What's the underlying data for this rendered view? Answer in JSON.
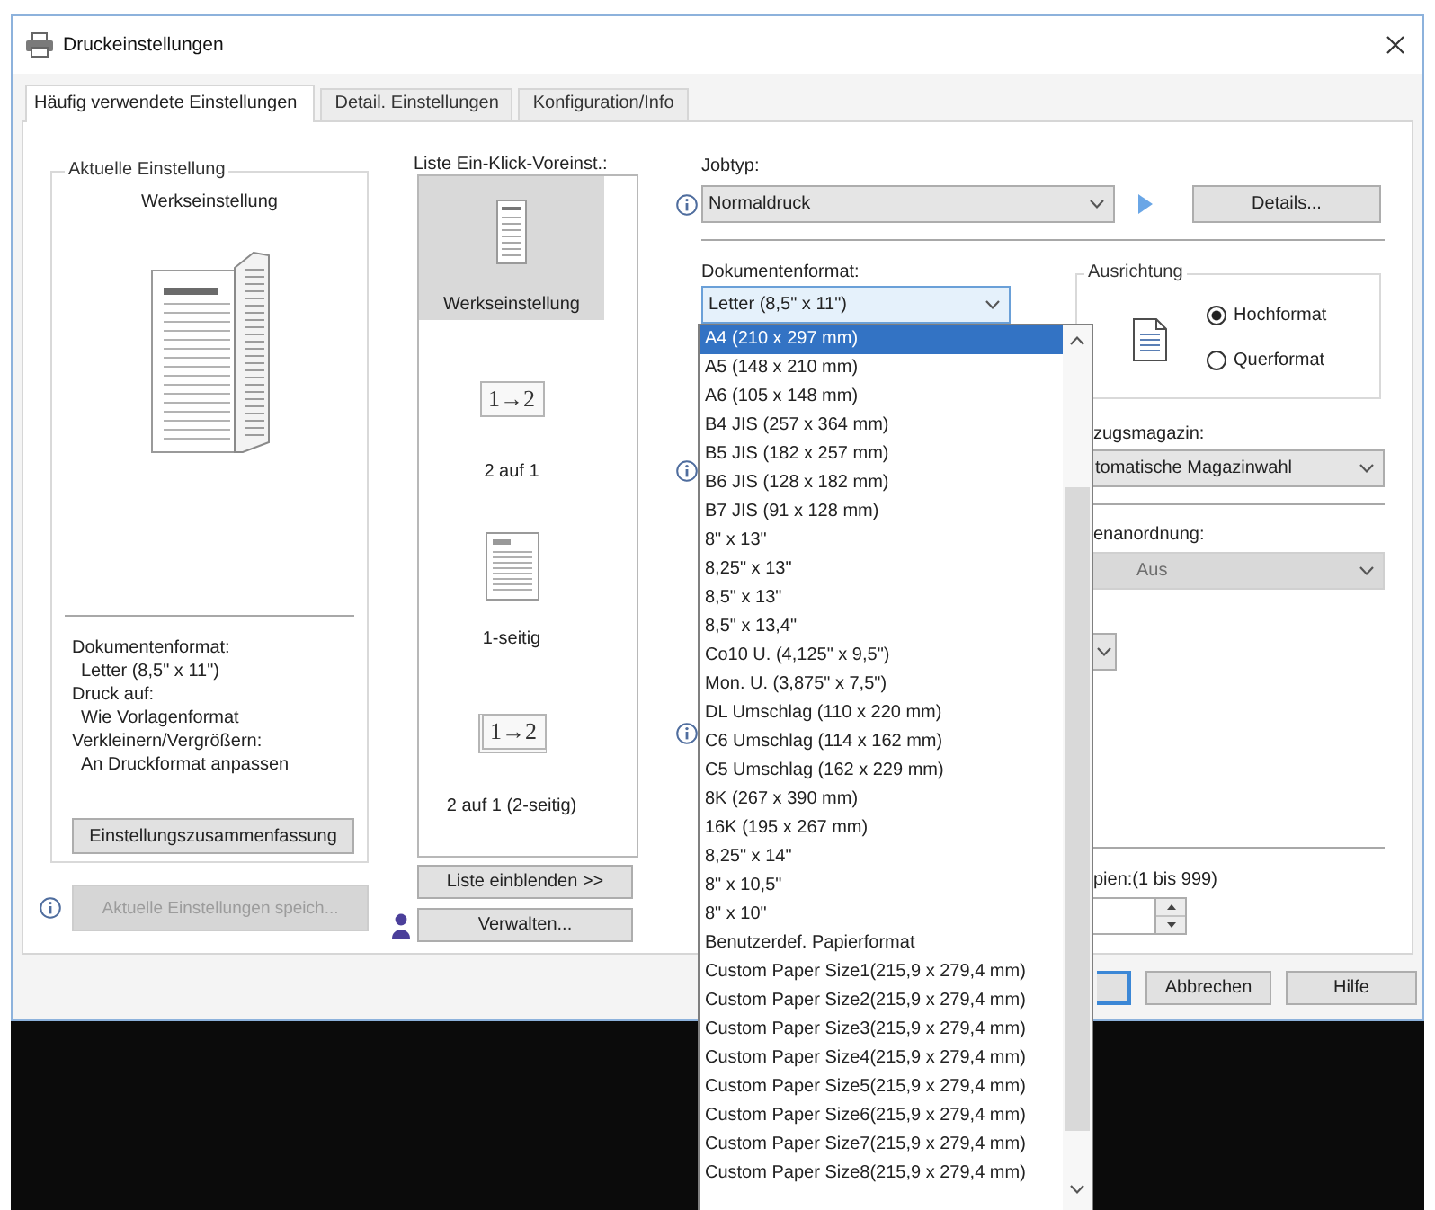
{
  "window": {
    "title": "Druckeinstellungen"
  },
  "tabs": [
    {
      "label": "Häufig verwendete Einstellungen",
      "selected": true
    },
    {
      "label": "Detail. Einstellungen",
      "selected": false
    },
    {
      "label": "Konfiguration/Info",
      "selected": false
    }
  ],
  "current_settings": {
    "title": "Aktuelle Einstellung",
    "preset": "Werkseinstellung",
    "summary": [
      {
        "label": "Dokumentenformat:",
        "value": "Letter (8,5\" x 11\")"
      },
      {
        "label": "Druck auf:",
        "value": "Wie Vorlagenformat"
      },
      {
        "label": "Verkleinern/Vergrößern:",
        "value": "An Druckformat anpassen"
      }
    ],
    "summary_button": "Einstellungszusammenfassung",
    "save_button": {
      "label": "Aktuelle Einstellungen speich...",
      "disabled": true
    }
  },
  "presets": {
    "label": "Liste Ein-Klick-Voreinst.:",
    "items": [
      {
        "kind": "narrow_page",
        "label": "Werkseinstellung",
        "selected": true
      },
      {
        "kind": "tile",
        "icon_label": "1→2",
        "label": "2 auf 1",
        "selected": false
      },
      {
        "kind": "page",
        "label": "1-seitig",
        "selected": false
      },
      {
        "kind": "tile_stacked",
        "icon_label": "1→2",
        "label": "2 auf 1 (2-seitig)",
        "selected": false
      }
    ],
    "buttons": [
      "Liste einblenden >>",
      "Verwalten..."
    ]
  },
  "job_type": {
    "label": "Jobtyp:",
    "value": "Normaldruck",
    "button": "Details..."
  },
  "document_format": {
    "label": "Dokumentenformat:",
    "value": "Letter (8,5\" x 11\")",
    "expanded": true,
    "options": [
      {
        "label": "A4 (210 x 297 mm)",
        "selected": true
      },
      {
        "label": "A5 (148 x 210 mm)",
        "selected": false
      },
      {
        "label": "A6 (105 x 148 mm)",
        "selected": false
      },
      {
        "label": "B4 JIS (257 x 364 mm)",
        "selected": false
      },
      {
        "label": "B5 JIS (182 x 257 mm)",
        "selected": false
      },
      {
        "label": "B6 JIS (128 x 182 mm)",
        "selected": false
      },
      {
        "label": "B7 JIS (91 x 128 mm)",
        "selected": false
      },
      {
        "label": "8\" x 13\"",
        "selected": false
      },
      {
        "label": "8,25\" x 13\"",
        "selected": false
      },
      {
        "label": "8,5\" x 13\"",
        "selected": false
      },
      {
        "label": "8,5\" x 13,4\"",
        "selected": false
      },
      {
        "label": "Co10 U. (4,125\" x 9,5\")",
        "selected": false
      },
      {
        "label": "Mon. U. (3,875\" x 7,5\")",
        "selected": false
      },
      {
        "label": "DL Umschlag (110 x 220 mm)",
        "selected": false
      },
      {
        "label": "C6 Umschlag (114 x 162 mm)",
        "selected": false
      },
      {
        "label": "C5 Umschlag (162 x 229 mm)",
        "selected": false
      },
      {
        "label": "8K (267 x 390 mm)",
        "selected": false
      },
      {
        "label": "16K (195 x 267 mm)",
        "selected": false
      },
      {
        "label": "8,25\" x 14\"",
        "selected": false
      },
      {
        "label": "8\" x 10,5\"",
        "selected": false
      },
      {
        "label": "8\" x 10\"",
        "selected": false
      },
      {
        "label": "Benutzerdef. Papierformat",
        "selected": false
      },
      {
        "label": "Custom Paper Size1(215,9 x 279,4 mm)",
        "selected": false
      },
      {
        "label": "Custom Paper Size2(215,9 x 279,4 mm)",
        "selected": false
      },
      {
        "label": "Custom Paper Size3(215,9 x 279,4 mm)",
        "selected": false
      },
      {
        "label": "Custom Paper Size4(215,9 x 279,4 mm)",
        "selected": false
      },
      {
        "label": "Custom Paper Size5(215,9 x 279,4 mm)",
        "selected": false
      },
      {
        "label": "Custom Paper Size6(215,9 x 279,4 mm)",
        "selected": false
      },
      {
        "label": "Custom Paper Size7(215,9 x 279,4 mm)",
        "selected": false
      },
      {
        "label": "Custom Paper Size8(215,9 x 279,4 mm)",
        "selected": false
      }
    ]
  },
  "orientation": {
    "label": "Ausrichtung",
    "options": [
      {
        "label": "Hochformat",
        "selected": true
      },
      {
        "label": "Querformat",
        "selected": false
      }
    ]
  },
  "covered_fields": [
    {
      "kind": "select",
      "label": "zugsmagazin:",
      "value": "tomatische Magazinwahl",
      "disabled": false
    },
    {
      "kind": "select",
      "label": "enanordnung:",
      "value": "Aus",
      "disabled": true
    },
    {
      "kind": "select_stub"
    },
    {
      "kind": "spin",
      "label": "pien:(1 bis 999)"
    }
  ],
  "dialog_buttons": [
    {
      "kind": "default"
    },
    {
      "kind": "normal",
      "label": "Abbrechen"
    },
    {
      "kind": "normal",
      "label": "Hilfe"
    }
  ]
}
